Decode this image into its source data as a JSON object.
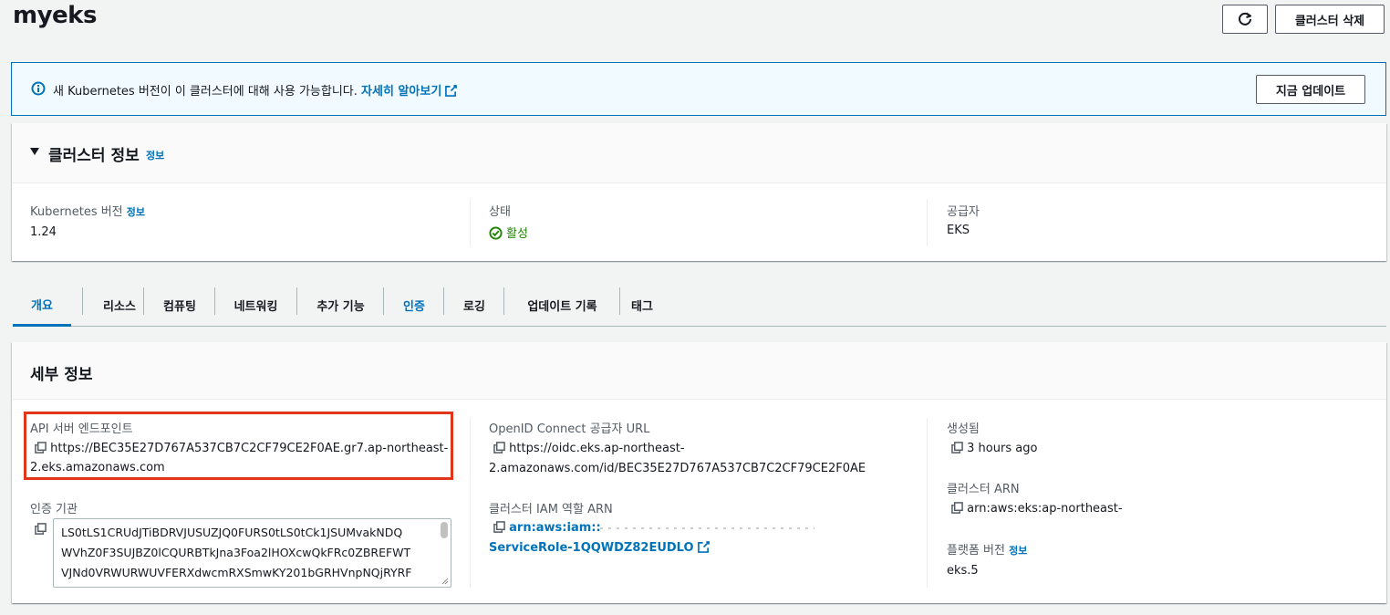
{
  "page": {
    "title": "myeks",
    "delete_button": "클러스터 삭제",
    "refresh_icon": "refresh-icon"
  },
  "banner": {
    "message": "새 Kubernetes 버전이 이 클러스터에 대해 사용 가능합니다. ",
    "link": "자세히 알아보기",
    "update_button": "지금 업데이트",
    "icon": "info-circle-icon",
    "accent": "#0073bb"
  },
  "cluster_info": {
    "title": "클러스터 정보",
    "info_link": "정보",
    "k8s_version_label": "Kubernetes 버전",
    "k8s_version_info": "정보",
    "k8s_version": "1.24",
    "status_label": "상태",
    "status_value": "활성",
    "status_color": "#1d8102",
    "provider_label": "공급자",
    "provider_value": "EKS"
  },
  "tabs": [
    {
      "label": "개요",
      "state": "active"
    },
    {
      "label": "리소스",
      "state": "normal"
    },
    {
      "label": "컴퓨팅",
      "state": "normal"
    },
    {
      "label": "네트워킹",
      "state": "normal"
    },
    {
      "label": "추가 기능",
      "state": "normal"
    },
    {
      "label": "인증",
      "state": "link"
    },
    {
      "label": "로깅",
      "state": "normal"
    },
    {
      "label": "업데이트 기록",
      "state": "normal"
    },
    {
      "label": "태그",
      "state": "normal"
    }
  ],
  "details": {
    "title": "세부 정보",
    "api_endpoint_label": "API 서버 엔드포인트",
    "api_endpoint_line1": "https://BEC35E27D767A537CB7C2CF79CE2F0AE.gr7.ap-northeast-",
    "api_endpoint_line2": "2.eks.amazonaws.com",
    "cert_label": "인증 기관",
    "cert_lines": [
      "LS0tLS1CRUdJTiBDRVJUSUZJQ0FURS0tLS0tCk1JSUMvakNDQ",
      "WVhZ0F3SUJBZ0lCQURBTkJna3Foa2lHOXcwQkFRc0ZBREFWT",
      "VJNd0VRWURWUVFERXdwcmRXSmwKY201bGRHVnpNQjRYRF"
    ],
    "oidc_label": "OpenID Connect 공급자 URL",
    "oidc_line1": "https://oidc.eks.ap-northeast-",
    "oidc_line2": "2.amazonaws.com/id/BEC35E27D767A537CB7C2CF79CE2F0AE",
    "iam_role_label": "클러스터 IAM 역할 ARN",
    "iam_role_line1": "arn:aws:iam::",
    "iam_role_line2": "ServiceRole-1QQWDZ82EUDLO",
    "created_label": "생성됨",
    "created_value": "3 hours ago",
    "arn_label": "클러스터 ARN",
    "arn_value": "arn:aws:eks:ap-northeast-",
    "platform_label": "플랫폼 버전",
    "platform_info": "정보",
    "platform_value": "eks.5",
    "highlight_color": "#e2361b"
  }
}
